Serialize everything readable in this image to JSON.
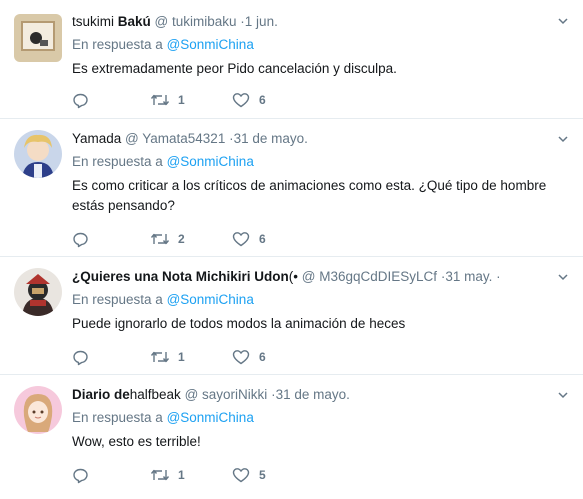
{
  "reply_prefix": "En respuesta a",
  "tweets": [
    {
      "name_pre": "tsukimi ",
      "name_bold": "Bakú",
      "name_post": "",
      "handle": "@ tukimibaku",
      "time": "1 jun.",
      "reply_to": "@SonmiChina",
      "text": "Es extremadamente peor Pido cancelación y disculpa.",
      "retweets": "1",
      "likes": "6"
    },
    {
      "name_pre": "Yamada",
      "name_bold": "",
      "name_post": "",
      "handle": "@ Yamata54321",
      "time": "31 de mayo.",
      "reply_to": "@SonmiChina",
      "text": "Es como criticar a los críticos de animaciones como esta. ¿Qué tipo de hombre estás pensando?",
      "retweets": "2",
      "likes": "6"
    },
    {
      "name_pre": "",
      "name_bold": "¿Quieres una Nota Michikiri Udon",
      "name_post": "(•",
      "handle": "@ M36gqCdDIESyLCf",
      "time": "31 may.",
      "reply_to": "@SonmiChina",
      "text": "Puede ignorarlo de todos modos la animación de heces",
      "retweets": "1",
      "likes": "6"
    },
    {
      "name_pre": "",
      "name_bold": "Diario de",
      "name_post": "halfbeak",
      "handle": "@ sayoriNikki",
      "time": "31 de mayo.",
      "reply_to": "@SonmiChina",
      "text": "Wow, esto es terrible!",
      "retweets": "1",
      "likes": "5"
    }
  ],
  "colors": {
    "link": "#1da1f2",
    "muted": "#657786",
    "border": "#e6ecf0"
  }
}
